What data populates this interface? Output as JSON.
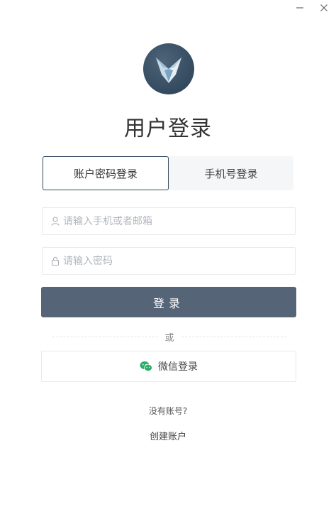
{
  "window": {
    "minimize_icon": "minimize-icon",
    "close_icon": "close-icon"
  },
  "header": {
    "logo_icon": "fox-logo-icon",
    "title": "用户登录"
  },
  "tabs": [
    {
      "label": "账户密码登录",
      "active": true
    },
    {
      "label": "手机号登录",
      "active": false
    }
  ],
  "form": {
    "account": {
      "icon": "user-icon",
      "placeholder": "请输入手机或者邮箱",
      "value": ""
    },
    "password": {
      "icon": "lock-icon",
      "placeholder": "请输入密码",
      "value": ""
    },
    "login_label": "登录"
  },
  "divider": {
    "label": "或"
  },
  "wechat": {
    "icon": "wechat-icon",
    "label": "微信登录"
  },
  "footer": {
    "no_account": "没有账号?",
    "create_account": "创建账户"
  },
  "colors": {
    "primary": "#556577",
    "logo": "#344a5e",
    "wechat": "#2aae67"
  }
}
